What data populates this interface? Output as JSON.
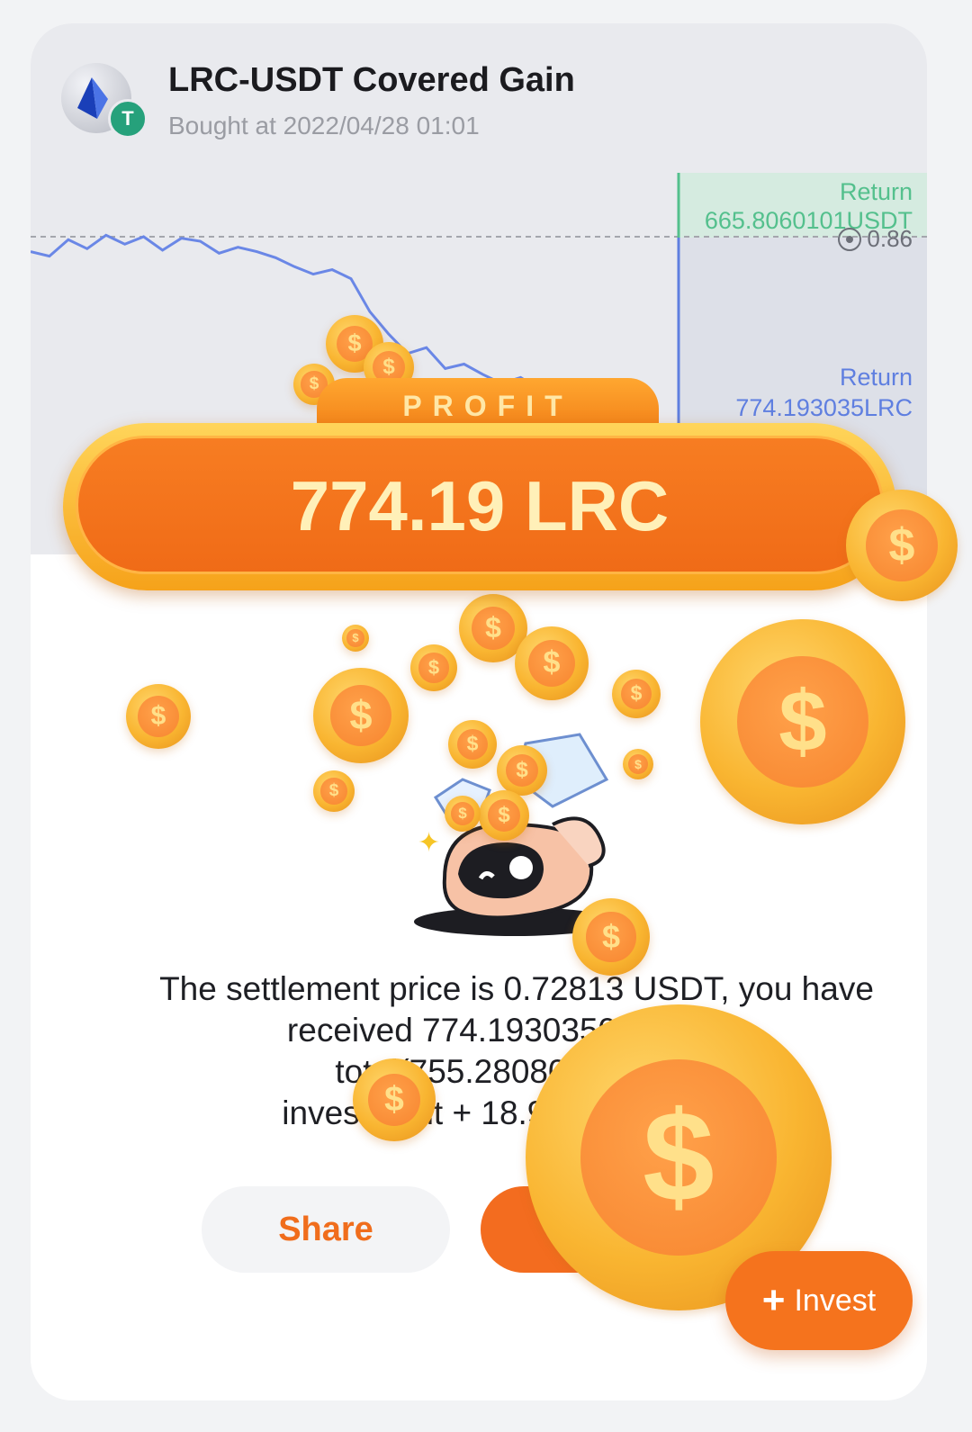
{
  "product": {
    "title": "LRC-USDT Covered Gain",
    "bought_at": "Bought at 2022/04/28 01:01",
    "token_icon": "lrc-icon",
    "quote_icon": "usdt-icon",
    "quote_badge_glyph": "T"
  },
  "chart_data": {
    "type": "line",
    "series": [
      {
        "values": [
          0.85,
          0.847,
          0.858,
          0.852,
          0.861,
          0.855,
          0.86,
          0.851,
          0.859,
          0.857,
          0.849,
          0.853,
          0.85,
          0.846,
          0.84,
          0.835,
          0.838,
          0.832,
          0.81,
          0.795,
          0.782,
          0.786,
          0.772,
          0.775,
          0.768,
          0.762,
          0.766,
          0.758,
          0.755,
          0.748,
          0.742,
          0.738,
          0.745,
          0.735,
          0.728
        ]
      }
    ],
    "strike_price": 0.86,
    "annotations": [
      {
        "label": "Return",
        "value": "665.8060101USDT"
      },
      {
        "label": "Return",
        "value": "774.193035LRC"
      }
    ]
  },
  "profit": {
    "badge": "PROFIT",
    "amount": "774.19 LRC"
  },
  "message": {
    "line1": "The settlement price is 0.72813 USDT, you have",
    "line2": "received 774.19303500 LRC in",
    "line3": "total(755.28080368 LRC",
    "line4": "investment + 18.91223132 LRC"
  },
  "actions": {
    "share_label": "Share",
    "invest_label": "Invest"
  },
  "colors": {
    "accent": "#f36c1f",
    "coin_gold": "#f9b531",
    "return_usdt": "#54c08d",
    "return_lrc": "#5f7fe0"
  }
}
